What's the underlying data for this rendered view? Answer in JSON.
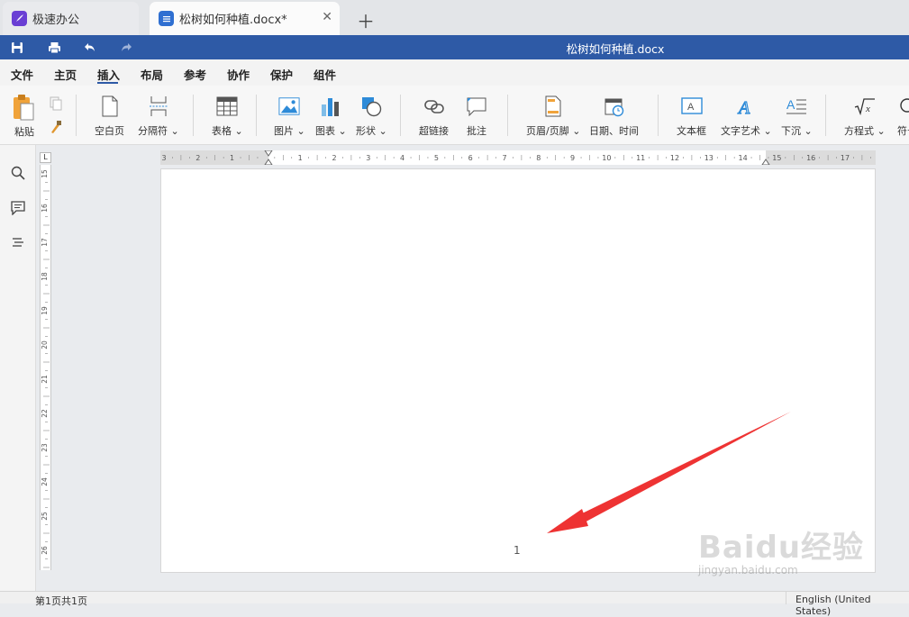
{
  "tabs": [
    {
      "label": "极速办公"
    },
    {
      "label": "松树如何种植.docx*"
    }
  ],
  "titlebar": {
    "doc_title": "松树如何种植.docx"
  },
  "menu": [
    "文件",
    "主页",
    "插入",
    "布局",
    "参考",
    "协作",
    "保护",
    "组件"
  ],
  "menu_active": "插入",
  "ribbon": {
    "paste": "粘贴",
    "blank_page": "空白页",
    "separator": "分隔符",
    "table": "表格",
    "image": "图片",
    "chart": "图表",
    "shape": "形状",
    "hyperlink": "超链接",
    "comment": "批注",
    "header_footer": "页眉/页脚",
    "datetime": "日期、时间",
    "textbox": "文本框",
    "text_art": "文字艺术",
    "dropcap": "下沉",
    "equation": "方程式",
    "symbol": "符号"
  },
  "ruler_h": [
    "3",
    "2",
    "1",
    "",
    "1",
    "2",
    "3",
    "4",
    "5",
    "6",
    "7",
    "8",
    "9",
    "10",
    "11",
    "12",
    "13",
    "14",
    "15",
    "16",
    "17"
  ],
  "ruler_v": [
    "15",
    "16",
    "17",
    "18",
    "19",
    "20",
    "21",
    "22",
    "23",
    "24",
    "25",
    "26"
  ],
  "page": {
    "page_number": "1"
  },
  "status": {
    "page_info": "第1页共1页",
    "language": "English (United States)"
  },
  "watermark": {
    "brand": "Baidu经验",
    "url": "jingyan.baidu.com"
  },
  "colors": {
    "titlebar": "#2e5aa6",
    "arrow": "#ee3333",
    "app_icon": "#6a3fd4"
  }
}
